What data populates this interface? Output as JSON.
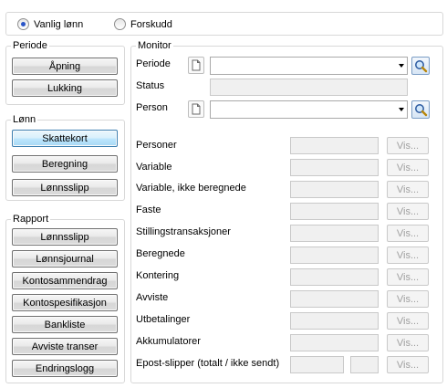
{
  "mode": {
    "options": [
      {
        "label": "Vanlig lønn",
        "selected": true
      },
      {
        "label": "Forskudd",
        "selected": false
      }
    ]
  },
  "periode": {
    "title": "Periode",
    "buttons": [
      "Åpning",
      "Lukking"
    ]
  },
  "lonn": {
    "title": "Lønn",
    "buttons": [
      "Skattekort",
      "Beregning",
      "Lønnsslipp"
    ],
    "focused_index": 0
  },
  "rapport": {
    "title": "Rapport",
    "buttons": [
      "Lønnsslipp",
      "Lønnsjournal",
      "Kontosammendrag",
      "Kontospesifikasjon",
      "Bankliste",
      "Avviste transer",
      "Endringslogg"
    ]
  },
  "monitor": {
    "title": "Monitor",
    "periode_label": "Periode",
    "periode_value": "",
    "status_label": "Status",
    "status_value": "",
    "person_label": "Person",
    "person_value": "",
    "rows": [
      {
        "label": "Personer",
        "value": "",
        "button": "Vis..."
      },
      {
        "label": "Variable",
        "value": "",
        "button": "Vis..."
      },
      {
        "label": "Variable, ikke beregnede",
        "value": "",
        "button": "Vis..."
      },
      {
        "label": "Faste",
        "value": "",
        "button": "Vis..."
      },
      {
        "label": "Stillingstransaksjoner",
        "value": "",
        "button": "Vis..."
      },
      {
        "label": "Beregnede",
        "value": "",
        "button": "Vis..."
      },
      {
        "label": "Kontering",
        "value": "",
        "button": "Vis..."
      },
      {
        "label": "Avviste",
        "value": "",
        "button": "Vis..."
      },
      {
        "label": "Utbetalinger",
        "value": "",
        "button": "Vis..."
      },
      {
        "label": "Akkumulatorer",
        "value": "",
        "button": "Vis..."
      }
    ],
    "epost": {
      "label": "Epost-slipper (totalt / ikke sendt)",
      "total": "",
      "not_sent": "",
      "button": "Vis..."
    }
  }
}
